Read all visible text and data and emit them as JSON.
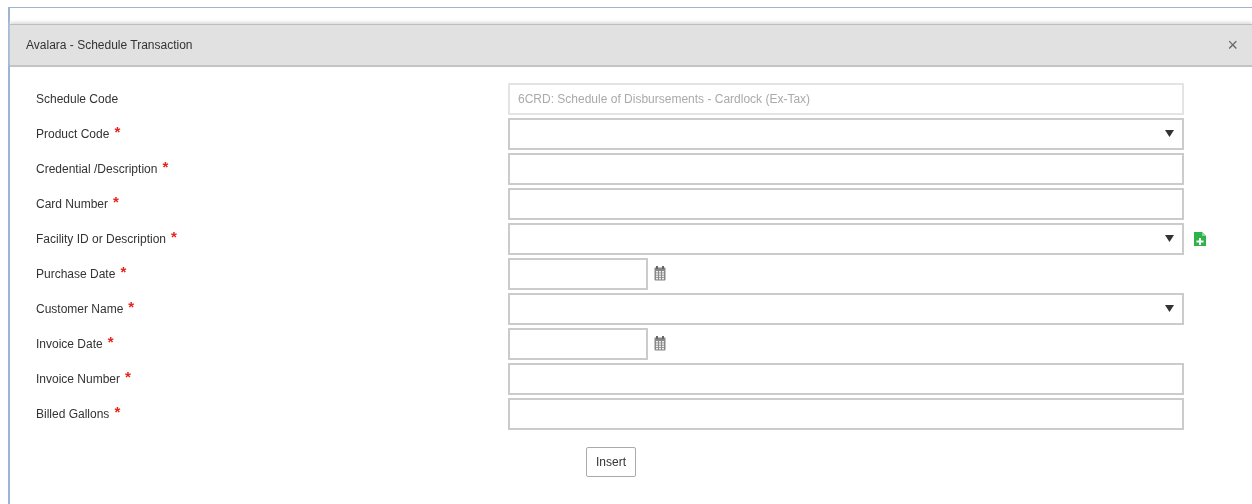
{
  "dialog": {
    "title": "Avalara - Schedule Transaction",
    "close": "×"
  },
  "fields": [
    {
      "label": "Schedule Code",
      "required": false,
      "kind": "text",
      "disabled": true,
      "value": "6CRD: Schedule of Disbursements - Cardlock (Ex-Tax)"
    },
    {
      "label": "Product Code",
      "required": true,
      "kind": "select",
      "disabled": false
    },
    {
      "label": "Credential /Description",
      "required": true,
      "kind": "text",
      "disabled": false
    },
    {
      "label": "Card Number",
      "required": true,
      "kind": "text",
      "disabled": false
    },
    {
      "label": "Facility ID or Description",
      "required": true,
      "kind": "select",
      "disabled": false,
      "add": true
    },
    {
      "label": "Purchase Date",
      "required": true,
      "kind": "date",
      "disabled": false
    },
    {
      "label": "Customer Name",
      "required": true,
      "kind": "select",
      "disabled": false
    },
    {
      "label": "Invoice Date",
      "required": true,
      "kind": "date",
      "disabled": false
    },
    {
      "label": "Invoice Number",
      "required": true,
      "kind": "text",
      "disabled": false
    },
    {
      "label": "Billed Gallons",
      "required": true,
      "kind": "text",
      "disabled": false
    }
  ],
  "required_mark": "*",
  "submit": "Insert"
}
